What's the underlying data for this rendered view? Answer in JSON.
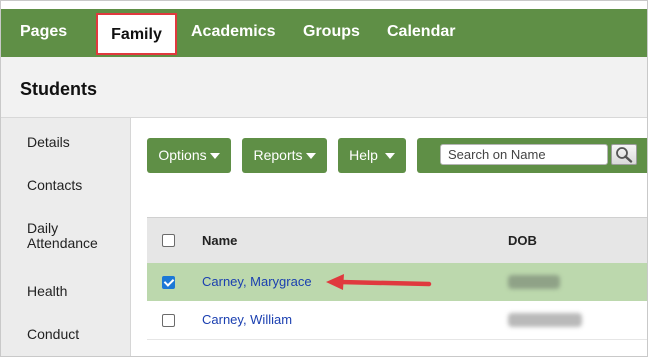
{
  "nav": {
    "items": [
      {
        "label": "Pages"
      },
      {
        "label": "Family"
      },
      {
        "label": "Academics"
      },
      {
        "label": "Groups"
      },
      {
        "label": "Calendar"
      }
    ],
    "active": "Family"
  },
  "page": {
    "title": "Students"
  },
  "sidebar": {
    "items": [
      {
        "label": "Details"
      },
      {
        "label": "Contacts"
      },
      {
        "label": "Daily Attendance"
      },
      {
        "label": "Health"
      },
      {
        "label": "Conduct"
      }
    ]
  },
  "toolbar": {
    "options_label": "Options",
    "reports_label": "Reports",
    "help_label": "Help",
    "search_placeholder": "Search on Name"
  },
  "table": {
    "columns": [
      "Name",
      "DOB"
    ],
    "rows": [
      {
        "name": "Carney, Marygrace",
        "selected": true
      },
      {
        "name": "Carney, William",
        "selected": false
      }
    ]
  },
  "colors": {
    "brand_green": "#5f8f46",
    "selected_row": "#bcd8ad",
    "highlight_red": "#e0393e",
    "link_blue": "#1a3fb0"
  },
  "icons": [
    "search-icon",
    "dropdown-caret-icon",
    "annotation-arrow-icon"
  ]
}
